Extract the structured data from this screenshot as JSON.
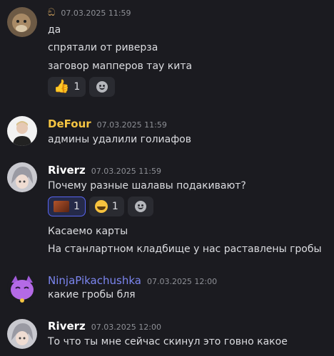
{
  "messages": [
    {
      "user": "ඞ",
      "user_color": "#c49a5a",
      "timestamp": "07.03.2025 11:59",
      "lines": [
        "да",
        "спрятали от риверза",
        "заговор мапперов тау кита"
      ],
      "reactions": [
        {
          "icon": "thumbs-up-icon",
          "count": "1"
        }
      ]
    },
    {
      "user": "DeFour",
      "user_color": "#f5c542",
      "timestamp": "07.03.2025 11:59",
      "lines": [
        "админы удалили голиафов"
      ]
    },
    {
      "user": "Riverz",
      "user_color": "#ffffff",
      "timestamp": "07.03.2025 11:59",
      "lines": [
        "Почему разные шалавы подакивают?"
      ],
      "reactions": [
        {
          "icon": "custom-image-emoji-icon",
          "count": "1"
        },
        {
          "icon": "laughing-emoji-icon",
          "count": "1"
        }
      ],
      "more_lines": [
        "Касаемо карты",
        "На станлартном кладбище у нас раставлены гробы"
      ]
    },
    {
      "user": "NinjaPikachushka",
      "user_color": "#7c86f0",
      "timestamp": "07.03.2025 12:00",
      "lines": [
        "какие гробы бля"
      ]
    },
    {
      "user": "Riverz",
      "user_color": "#ffffff",
      "timestamp": "07.03.2025 12:00",
      "lines": [
        "То что ты мне сейчас скинул это говно какое"
      ]
    }
  ],
  "colors": {
    "background": "#1b1b20",
    "reaction_bg": "#2a2b31",
    "reaction_active_border": "#5865f2"
  }
}
